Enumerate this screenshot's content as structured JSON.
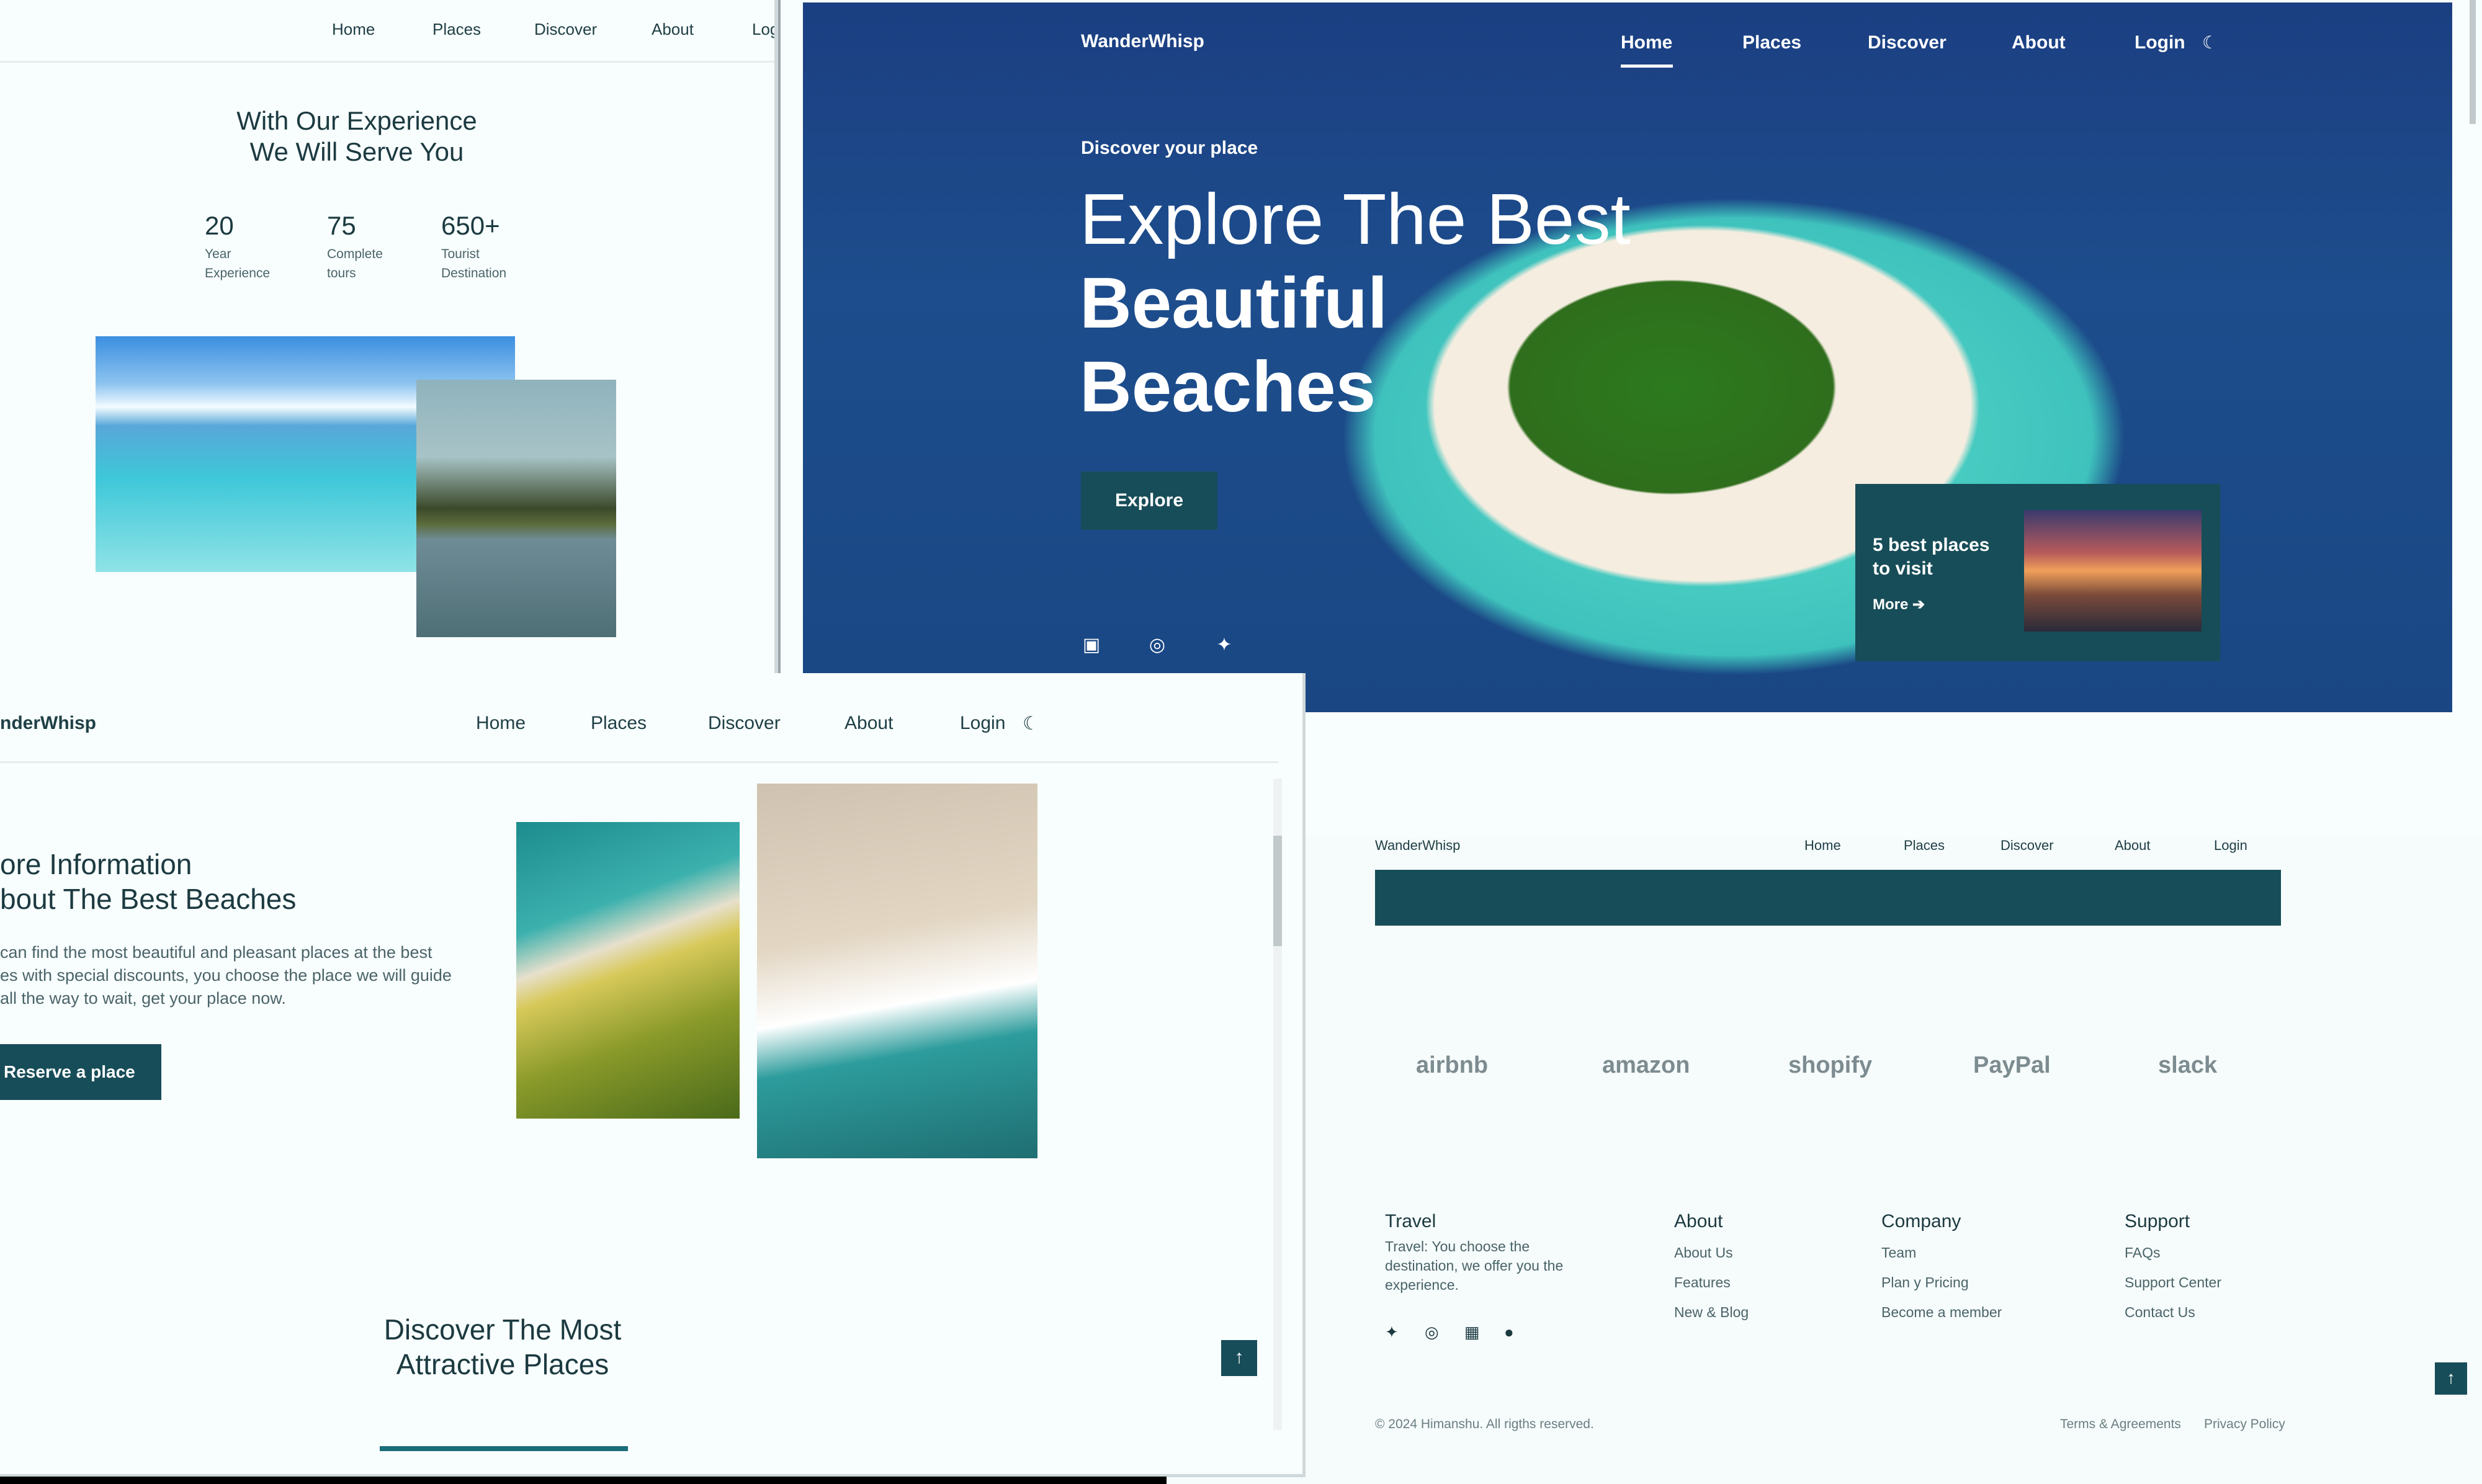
{
  "windowA": {
    "nav": [
      "Home",
      "Places",
      "Discover",
      "About",
      "Log"
    ],
    "title_line1": "With Our Experience",
    "title_line2": "We Will Serve You",
    "stats": [
      {
        "num": "20",
        "line1": "Year",
        "line2": "Experience"
      },
      {
        "num": "75",
        "line1": "Complete",
        "line2": "tours"
      },
      {
        "num": "650+",
        "line1": "Tourist",
        "line2": "Destination"
      }
    ]
  },
  "windowB": {
    "logo": "WanderWhisp",
    "nav": [
      "Home",
      "Places",
      "Discover",
      "About",
      "Login"
    ],
    "kicker": "Discover your place",
    "headline_light": "Explore The Best",
    "headline_bold": "Beautiful Beaches",
    "explore_label": "Explore",
    "card": {
      "title": "5 best places to visit",
      "more": "More ➔"
    }
  },
  "windowC": {
    "nav": [
      "WanderWhisp",
      "Home",
      "Places",
      "Discover",
      "About",
      "Login"
    ],
    "brands": [
      "airbnb",
      "amazon",
      "shopify",
      "PayPal",
      "slack"
    ],
    "travel_h": "Travel",
    "travel_desc": "Travel: You choose the destination, we offer you the experience.",
    "about_h": "About",
    "about_links": [
      "About Us",
      "Features",
      "New & Blog"
    ],
    "company_h": "Company",
    "company_links": [
      "Team",
      "Plan y Pricing",
      "Become a member"
    ],
    "support_h": "Support",
    "support_links": [
      "FAQs",
      "Support Center",
      "Contact Us"
    ],
    "copyright": "© 2024 Himanshu. All rigths reserved.",
    "terms": "Terms & Agreements",
    "privacy": "Privacy Policy"
  },
  "windowD": {
    "logo": "nderWhisp",
    "nav": [
      "Home",
      "Places",
      "Discover",
      "About",
      "Login"
    ],
    "info_line1": "ore Information",
    "info_line2": "bout The Best Beaches",
    "info_p1": " can find the most beautiful and pleasant places at the best",
    "info_p2": "es with special discounts, you choose the place we will guide",
    "info_p3": " all the way to wait, get your place now.",
    "reserve_label": "Reserve a place",
    "discover_line1": "Discover The Most",
    "discover_line2": "Attractive Places"
  }
}
